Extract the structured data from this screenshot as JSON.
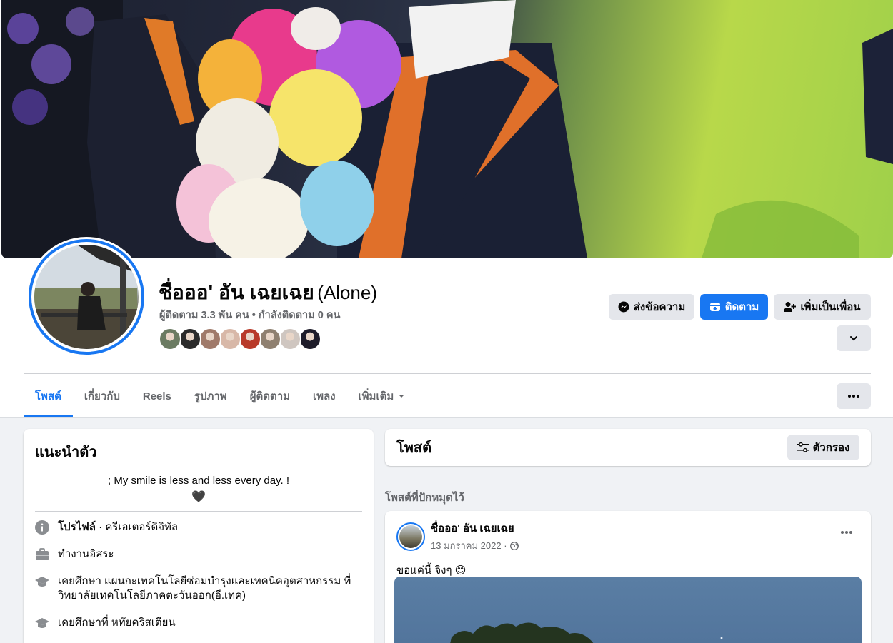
{
  "profile": {
    "name": "ชื่อออ' อัน เฉยเฉย",
    "alt_name": "(Alone)",
    "stats": "ผู้ติดตาม 3.3 พัน คน • กำลังติดตาม 0 คน"
  },
  "friends_avatars": [
    "#6b7b62",
    "#2b2b2b",
    "#a07a6a",
    "#d8b8a8",
    "#b83a2a",
    "#8f8070",
    "#cfc6c0",
    "#1e1c2a"
  ],
  "actions": {
    "message": "ส่งข้อความ",
    "follow": "ติดตาม",
    "add_friend": "เพิ่มเป็นเพื่อน"
  },
  "tabs": [
    {
      "label": "โพสต์"
    },
    {
      "label": "เกี่ยวกับ"
    },
    {
      "label": "Reels"
    },
    {
      "label": "รูปภาพ"
    },
    {
      "label": "ผู้ติดตาม"
    },
    {
      "label": "เพลง"
    },
    {
      "label": "เพิ่มเติม"
    }
  ],
  "intro": {
    "title": "แนะนำตัว",
    "bio": "; My smile is less and less every day. !",
    "bio_emoji": "🖤",
    "profile_label": "โปรไฟล์",
    "profile_type": " · ครีเอเตอร์ดิจิทัล",
    "work": "ทำงานอิสระ",
    "education1": "เคยศึกษา แผนกะเทคโนโลยีซ่อมบำรุงและเทคนิคอุตสาหกรรม ที่ วิทยาลัยเทคโนโลยีภาคตะวันออก(อี.เทค)",
    "education2": "เคยศึกษาที่ หทัยคริสเตียน"
  },
  "posts": {
    "title": "โพสต์",
    "filter": "ตัวกรอง",
    "pinned_label": "โพสต์ที่ปักหมุดไว้"
  },
  "post": {
    "author": "ชื่อออ' อัน เฉยเฉย",
    "date": "13 มกราคม 2022 ·",
    "text": "ขอแค่นี้  จิงๆ  😊"
  },
  "colors": {
    "accent": "#1877f2",
    "secondary_text": "#65676b",
    "button_grey": "#e4e6eb",
    "page_bg": "#f0f2f5"
  },
  "icons": [
    "messenger-icon",
    "follow-icon",
    "add-friend-icon",
    "chevron-down-icon",
    "more-icon",
    "info-icon",
    "briefcase-icon",
    "graduation-cap-icon",
    "filter-icon",
    "globe-icon"
  ]
}
